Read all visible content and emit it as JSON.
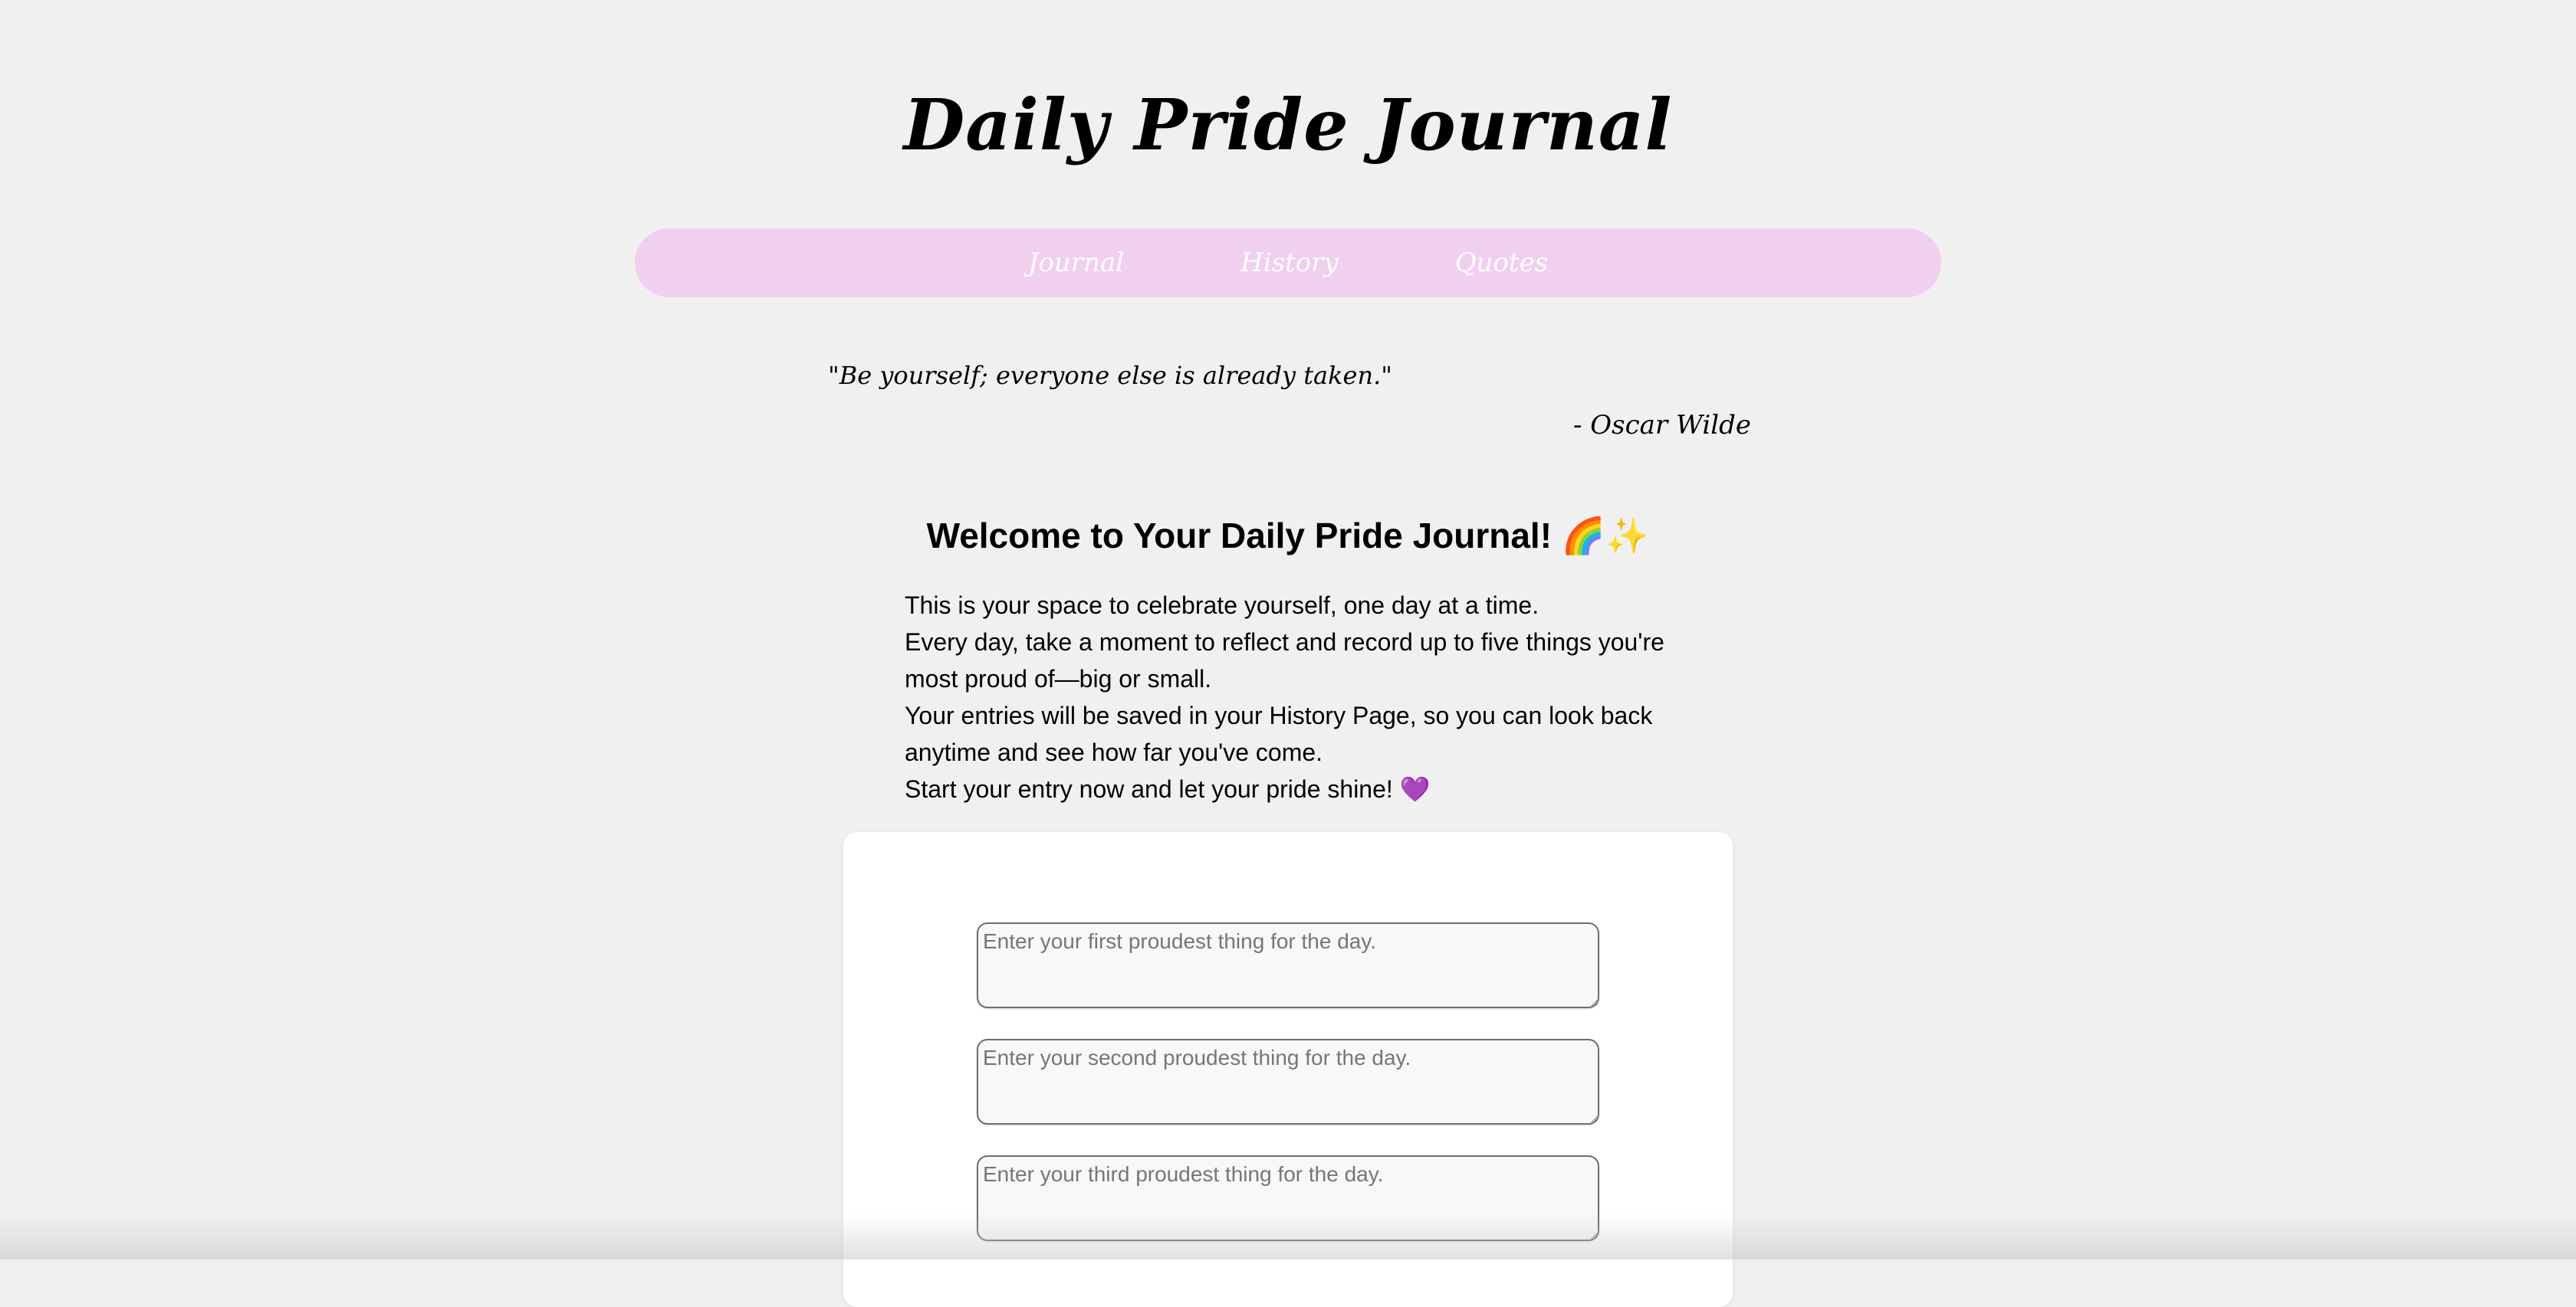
{
  "header": {
    "title": "Daily Pride Journal"
  },
  "nav": {
    "items": [
      {
        "label": "Journal"
      },
      {
        "label": "History"
      },
      {
        "label": "Quotes"
      }
    ],
    "background_color": "#f1d0ef"
  },
  "quote": {
    "text": "\"Be yourself; everyone else is already taken.\"",
    "author": "- Oscar Wilde"
  },
  "welcome": {
    "title": "Welcome to Your Daily Pride Journal! 🌈✨",
    "lines": [
      "This is your space to celebrate yourself, one day at a time.",
      "Every day, take a moment to reflect and record up to five things you're most proud of—big or small.",
      "Your entries will be saved in your History Page, so you can look back anytime and see how far you've come.",
      "Start your entry now and let your pride shine! 💜"
    ]
  },
  "form": {
    "entries": [
      {
        "placeholder": "Enter your first proudest thing for the day.",
        "value": ""
      },
      {
        "placeholder": "Enter your second proudest thing for the day.",
        "value": ""
      },
      {
        "placeholder": "Enter your third proudest thing for the day.",
        "value": ""
      }
    ]
  },
  "colors": {
    "page_background": "#f0f0f0",
    "card_background": "#ffffff",
    "nav_text": "#ffffff"
  }
}
